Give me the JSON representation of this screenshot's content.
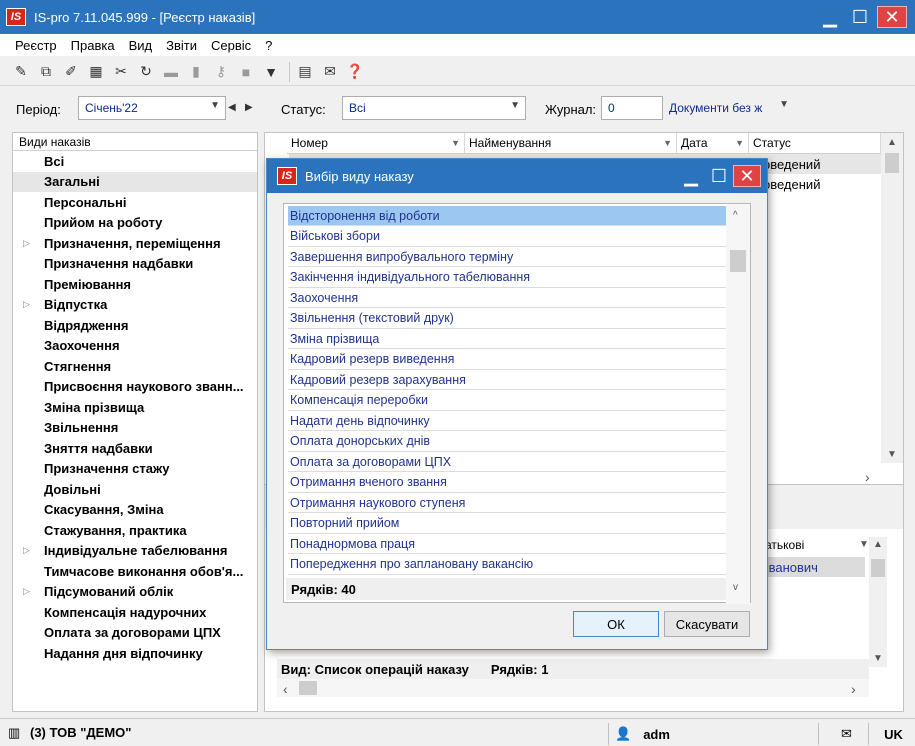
{
  "window": {
    "logo": "IS",
    "title": "IS-pro 7.11.045.999 - [Реєстр наказів]",
    "minimize": "▁",
    "maximize": "☐",
    "close": "✕"
  },
  "menu": [
    "Реєстр",
    "Правка",
    "Вид",
    "Звіти",
    "Сервіс",
    "?"
  ],
  "filters": {
    "period_label": "Період:",
    "period_value": "Січень'22",
    "status_label": "Статус:",
    "status_value": "Всі",
    "journal_label": "Журнал:",
    "journal_value": "0",
    "journal_name": "Документи без ж"
  },
  "left_panel": {
    "header": "Види наказів",
    "items": [
      {
        "label": "Всі",
        "expandable": false
      },
      {
        "label": "Загальні",
        "expandable": false
      },
      {
        "label": "Персональні",
        "expandable": false
      },
      {
        "label": "Прийом на роботу",
        "expandable": false
      },
      {
        "label": "Призначення, переміщення",
        "expandable": true
      },
      {
        "label": "Призначення надбавки",
        "expandable": false
      },
      {
        "label": "Преміювання",
        "expandable": false
      },
      {
        "label": "Відпустка",
        "expandable": true
      },
      {
        "label": "Відрядження",
        "expandable": false
      },
      {
        "label": "Заохочення",
        "expandable": false
      },
      {
        "label": "Стягнення",
        "expandable": false
      },
      {
        "label": "Присвоєння наукового званн...",
        "expandable": false
      },
      {
        "label": "Зміна прізвища",
        "expandable": false
      },
      {
        "label": "Звільнення",
        "expandable": false
      },
      {
        "label": "Зняття надбавки",
        "expandable": false
      },
      {
        "label": "Призначення стажу",
        "expandable": false
      },
      {
        "label": "Довільні",
        "expandable": false
      },
      {
        "label": "Скасування, Зміна",
        "expandable": false
      },
      {
        "label": "Стажування, практика",
        "expandable": false
      },
      {
        "label": "Індивідуальне табелювання",
        "expandable": true
      },
      {
        "label": "Тимчасове виконання обов'я...",
        "expandable": false
      },
      {
        "label": "Підсумований облік",
        "expandable": true
      },
      {
        "label": "Компенсація надурочних",
        "expandable": false
      },
      {
        "label": "Оплата за договорами ЦПХ",
        "expandable": false
      },
      {
        "label": "Надання дня відпочинку",
        "expandable": false
      }
    ],
    "selected_index": 1
  },
  "grid": {
    "columns": [
      "Номер",
      "Найменування",
      "Дата",
      "Статус"
    ],
    "rows": [
      {
        "status": "оведений"
      },
      {
        "status": "оведений"
      }
    ],
    "bottom_column": "атькові",
    "bottom_row": "Іванович",
    "status_text": "Вид: Список операцій наказу",
    "rows_count": "Рядків: 1"
  },
  "dialog": {
    "logo": "IS",
    "title": "Вибір виду наказу",
    "items": [
      "Відсторонення від роботи",
      "Військові збори",
      "Завершення випробувального терміну",
      "Закінчення індивідуального табелювання",
      "Заохочення",
      "Звільнення (текстовий друк)",
      "Зміна прізвища",
      "Кадровий резерв виведення",
      "Кадровий резерв зарахування",
      "Компенсація переробки",
      "Надати день відпочинку",
      "Оплата донорських днів",
      "Оплата за договорами ЦПХ",
      "Отримання вченого звання",
      "Отримання наукового ступеня",
      "Повторний прийом",
      "Понаднормова праця",
      "Попередження про заплановану вакансію"
    ],
    "selected_index": 0,
    "rows_count": "Рядків: 40",
    "ok_label": "ОК",
    "cancel_label": "Скасувати"
  },
  "statusbar": {
    "company": "(3) ТОВ \"ДЕМО\"",
    "user": "adm",
    "lang": "UK"
  },
  "colors": {
    "titlebar": "#2b74bd",
    "selection": "#9cc7f0",
    "list_text": "#22338e"
  }
}
